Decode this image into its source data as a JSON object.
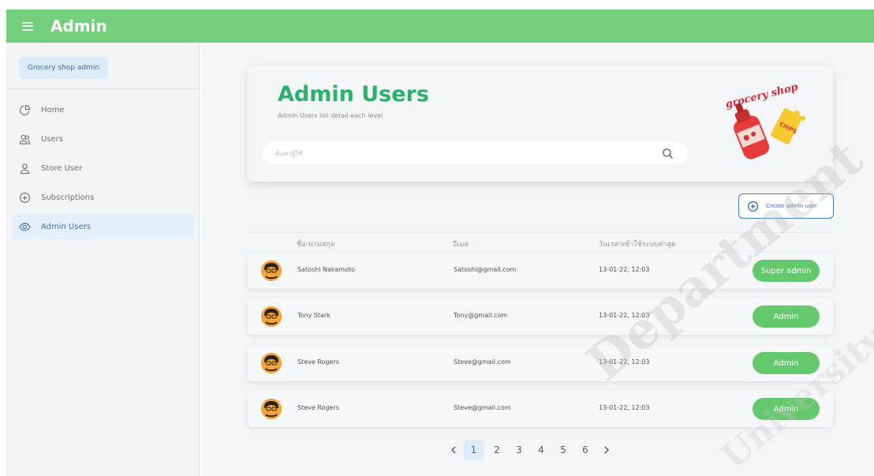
{
  "app": {
    "title": "Admin"
  },
  "sidebar": {
    "shop_badge": "Grocery shop admin",
    "items": [
      {
        "label": "Home",
        "icon": "pie-chart-icon",
        "active": false
      },
      {
        "label": "Users",
        "icon": "users-icon",
        "active": false
      },
      {
        "label": "Store User",
        "icon": "user-icon",
        "active": false
      },
      {
        "label": "Subscriptions",
        "icon": "plus-circle-icon",
        "active": false
      },
      {
        "label": "Admin Users",
        "icon": "eye-icon",
        "active": true
      }
    ]
  },
  "header": {
    "title": "Admin Users",
    "subtitle": "Admin Users list detail each level",
    "search_placeholder": "ค้นหาผู้ใช้"
  },
  "create_button": {
    "label": "Create admin user"
  },
  "table": {
    "columns": [
      "ชื่อ-นามสกุล",
      "อีเมล",
      "วันเวลาเข้าใช้ระบบล่าสุด"
    ],
    "rows": [
      {
        "name": "Satoshi Nakamoto",
        "email": "Satoshi@gmail.com",
        "last_login": "13-01-22, 12:03",
        "role": "Super admin"
      },
      {
        "name": "Tony Stark",
        "email": "Tony@gmail.com",
        "last_login": "13-01-22, 12:03",
        "role": "Admin"
      },
      {
        "name": "Steve Rogers",
        "email": "Steve@gmail.com",
        "last_login": "13-01-22, 12:03",
        "role": "Admin"
      },
      {
        "name": "Steve Rogers",
        "email": "Steve@gmail.com",
        "last_login": "13-01-22, 12:03",
        "role": "Admin"
      }
    ]
  },
  "pagination": {
    "pages": [
      "1",
      "2",
      "3",
      "4",
      "5",
      "6"
    ],
    "current": "1"
  },
  "illustration": {
    "caption": "grocery shop",
    "label": "CHIPS"
  },
  "watermark": {
    "line1": "Department",
    "line2": "University"
  },
  "colors": {
    "topbar": "#74cf7c",
    "title_green": "#27b36a",
    "role_green": "#64c96d",
    "active_blue": "#3e6fb4",
    "active_bg": "#e3f0fc"
  }
}
